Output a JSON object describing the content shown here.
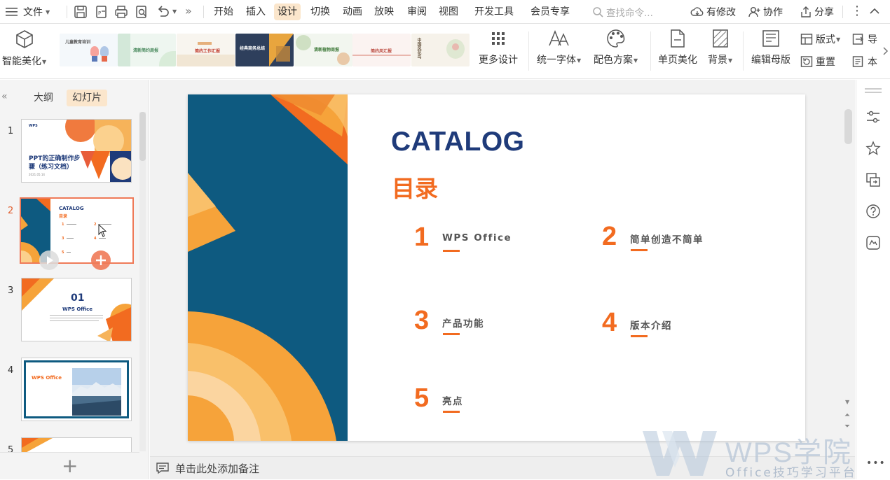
{
  "menubar": {
    "file_label": "文件",
    "tabs": [
      "开始",
      "插入",
      "设计",
      "切换",
      "动画",
      "放映",
      "审阅",
      "视图",
      "开发工具",
      "会员专享"
    ],
    "active_tab": "设计",
    "search_placeholder": "查找命令...",
    "modify_label": "有修改",
    "collab_label": "协作",
    "share_label": "分享"
  },
  "ribbon": {
    "smart_beautify": "智能美化",
    "more_designs": "更多设计",
    "unify_font": "统一字体",
    "color_scheme": "配色方案",
    "page_beautify": "单页美化",
    "background": "背景",
    "edit_master": "编辑母版",
    "layout": "版式",
    "reset": "重置",
    "import": "导",
    "this": "本",
    "templates": [
      {
        "title": "儿童教育培训"
      },
      {
        "title": "清新简约周报"
      },
      {
        "title": "简约工作汇报"
      },
      {
        "title": "经典商务总结"
      },
      {
        "title": "清新植物周报"
      },
      {
        "title": "简约风汇报"
      },
      {
        "title": "中国风花鸟"
      }
    ]
  },
  "left_panel": {
    "outline_tab": "大纲",
    "slides_tab": "幻灯片",
    "slides": [
      {
        "num": "1",
        "title": "PPT的正确制作步骤（练习文档）",
        "subtitle": "2021.05.14",
        "logo": "WPS"
      },
      {
        "num": "2",
        "title": "CATALOG",
        "subtitle": "目录"
      },
      {
        "num": "3",
        "title": "01",
        "subtitle": "WPS Office"
      },
      {
        "num": "4",
        "title": "WPS Office"
      },
      {
        "num": "5"
      }
    ]
  },
  "slide": {
    "title": "CATALOG",
    "subtitle": "目录",
    "items": [
      {
        "num": "1",
        "label": "WPS Office"
      },
      {
        "num": "2",
        "label": "简单创造不简单"
      },
      {
        "num": "3",
        "label": "产品功能"
      },
      {
        "num": "4",
        "label": "版本介绍"
      },
      {
        "num": "5",
        "label": "亮点"
      }
    ]
  },
  "notes": {
    "placeholder": "单击此处添加备注"
  },
  "watermark": {
    "brand": "WPS学院",
    "subtitle": "Office技巧学习平台"
  },
  "colors": {
    "accent_orange": "#f26b20",
    "navy": "#1f3b7a",
    "teal_blue": "#0e5a80",
    "active_tab_bg": "#fbe6cc",
    "slide_selected_border": "#ef7a58"
  }
}
